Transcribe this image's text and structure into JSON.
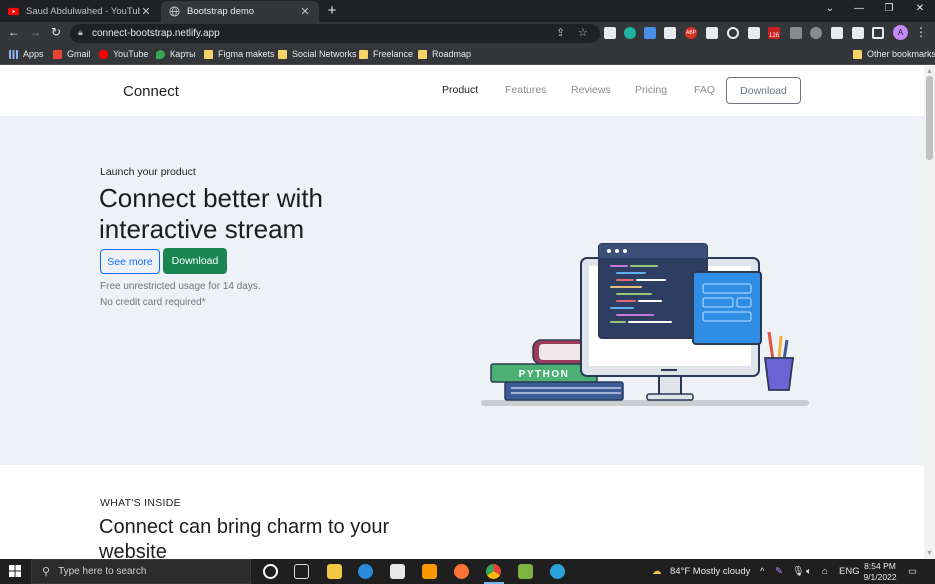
{
  "browser": {
    "tabs": [
      {
        "title": "Saud Abdulwahed - YouTube",
        "active": false
      },
      {
        "title": "Bootstrap demo",
        "active": true
      }
    ],
    "url": "connect-bootstrap.netlify.app",
    "bookmarks": [
      "Apps",
      "Gmail",
      "YouTube",
      "Карты",
      "Figma makets",
      "Social Networks",
      "Freelance",
      "Roadmap"
    ],
    "other_bookmarks": "Other bookmarks",
    "extension_badge": "126",
    "profile_initial": "A",
    "abp_label": "ABP"
  },
  "site": {
    "brand": "Connect",
    "nav": [
      "Product",
      "Features",
      "Reviews",
      "Pricing",
      "FAQ"
    ],
    "nav_active": "Product",
    "nav_download": "Download"
  },
  "hero": {
    "eyebrow": "Launch your product",
    "headline": "Connect better with interactive stream",
    "see_more": "See more",
    "download": "Download",
    "note_line1": "Free unrestricted usage for 14 days.",
    "note_line2": "No credit card required*",
    "book_label": "PYTHON"
  },
  "section": {
    "label": "WHAT'S INSIDE",
    "headline": "Connect can bring charm to your website"
  },
  "taskbar": {
    "search_placeholder": "Type here to search",
    "weather": "84°F  Mostly cloudy",
    "language": "ENG",
    "time": "8:54 PM",
    "date": "9/1/2022"
  },
  "colors": {
    "primary": "#0d6efd",
    "success": "#198754",
    "hero_bg": "#eef2f7",
    "chrome_dark": "#202124"
  }
}
